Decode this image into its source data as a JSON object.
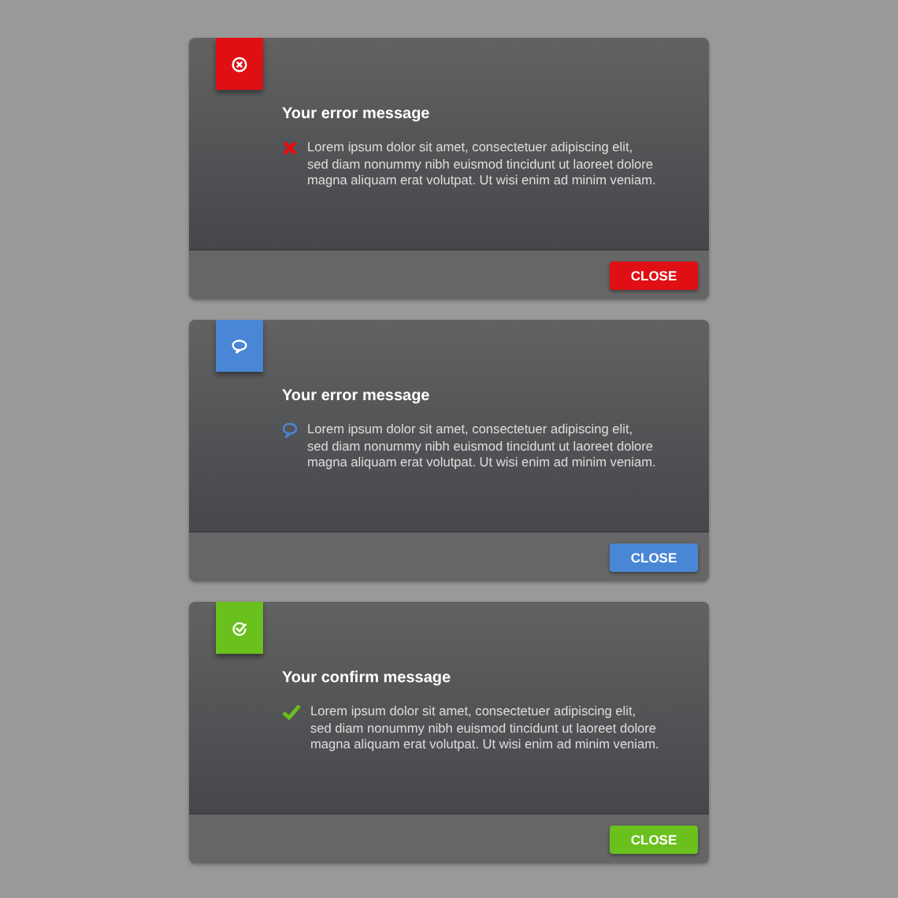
{
  "dialogs": [
    {
      "kind": "error",
      "color": "#e00f14",
      "title": "Your error message",
      "message": "Lorem ipsum dolor sit amet, consectetuer adipiscing elit, sed diam nonummy nibh euismod tincidunt ut laoreet dolore magna aliquam erat volutpat. Ut wisi enim ad minim veniam.",
      "button": "CLOSE"
    },
    {
      "kind": "info",
      "color": "#4a86d6",
      "title": "Your error message",
      "message": "Lorem ipsum dolor sit amet, consectetuer adipiscing elit, sed diam nonummy nibh euismod tincidunt ut laoreet dolore magna aliquam erat volutpat. Ut wisi enim ad minim veniam.",
      "button": "CLOSE"
    },
    {
      "kind": "confirm",
      "color": "#6ac01c",
      "title": "Your confirm message",
      "message": "Lorem ipsum dolor sit amet, consectetuer adipiscing elit, sed diam nonummy nibh euismod tincidunt ut laoreet dolore magna aliquam erat volutpat. Ut wisi enim ad minim veniam.",
      "button": "CLOSE"
    }
  ]
}
